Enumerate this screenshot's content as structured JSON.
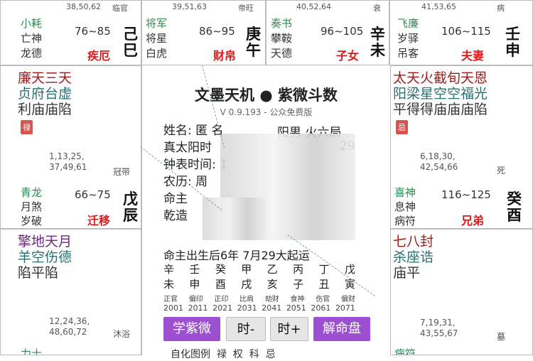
{
  "top_row": [
    {
      "header_nums": "38,50,62",
      "header_stage": "临官",
      "star1": "小耗",
      "star2": "亡神",
      "star3": "龙德",
      "range": "76~85",
      "palace": "疾厄",
      "gz1": "己",
      "gz2": "巳"
    },
    {
      "header_nums": "39,51,63",
      "header_stage": "帝旺",
      "star1": "将军",
      "star2": "将星",
      "star3": "白虎",
      "range": "86~95",
      "palace": "财帛",
      "gz1": "庚",
      "gz2": "午"
    },
    {
      "header_nums": "40,52,64",
      "header_stage": "衰",
      "star1": "奏书",
      "star2": "攀鞍",
      "star3": "天德",
      "range": "96~105",
      "palace": "子女",
      "gz1": "辛",
      "gz2": "未"
    },
    {
      "header_nums": "41,53,65",
      "header_stage": "病",
      "star1": "飞廉",
      "star2": "岁驿",
      "star3": "吊客",
      "range": "106~115",
      "palace": "夫妻",
      "gz1": "壬",
      "gz2": "申"
    }
  ],
  "left_chen": {
    "main_stars": "廉天三天",
    "main_stars2": "贞府台虚",
    "bright": "利庙庙陷",
    "badge": "禄",
    "nums1": "1,13,25,",
    "nums2": "37,49,61",
    "stage": "冠带",
    "star1": "青龙",
    "star2": "月煞",
    "star3": "岁破",
    "range": "66~75",
    "palace": "迁移",
    "gz1": "戊",
    "gz2": "辰"
  },
  "left_mao": {
    "main_stars": "擎地天月",
    "main_stars2": "羊空伤德",
    "bright": "陷平陷",
    "nums1": "12,24,36,",
    "nums2": "48,60,72",
    "stage": "沐浴",
    "bottom": "力士"
  },
  "right_you": {
    "main_stars": "太天火截旬天恩",
    "main_stars2": "阳梁星空空福光",
    "bright": "平得得庙庙庙陷",
    "badge": "忌",
    "nums1": "6,18,30,",
    "nums2": "42,54,66",
    "stage": "死",
    "star1": "喜神",
    "star2": "息神",
    "star3": "病符",
    "range": "116~125",
    "palace": "兄弟",
    "gz1": "癸",
    "gz2": "酉"
  },
  "right_xu": {
    "main_stars": "七八封",
    "main_stars2": "杀座诰",
    "bright": "庙平",
    "nums1": "7,19,31,",
    "nums2": "43,55,67",
    "stage": "墓",
    "bottom": "病符"
  },
  "center": {
    "title": "文墨天机 ● 紫微斗数",
    "version": "V 0.9.193 - 公众免费版",
    "name_label": "姓名: 匿 名",
    "gender": "阳男 火六局",
    "solar_label": "真太阳时",
    "solar_tail": "29",
    "clock_label": "钟表时间: 1",
    "lunar_label": "农历: 周",
    "master_label": "命主",
    "body_label": "乾造",
    "after_birth": "命主出生后6年 7月29大起运",
    "pillars_top": [
      "辛",
      "壬",
      "癸",
      "甲",
      "乙",
      "丙",
      "丁",
      "戊"
    ],
    "pillars_bot": [
      "未",
      "申",
      "酉",
      "戌",
      "亥",
      "子",
      "丑",
      "寅"
    ],
    "ten_gods": [
      "正官",
      "偏印",
      "正印",
      "比肩",
      "劫财",
      "食神",
      "伤官",
      "偏财"
    ],
    "years": [
      "2001",
      "2011",
      "2021",
      "2031",
      "2041",
      "2051",
      "2061",
      "2071"
    ],
    "bottom_row": "自化图例  禄  权  科  忌"
  },
  "buttons": {
    "ziwei": "学紫微",
    "prev": "时-",
    "next": "时+",
    "interpret": "解命盘"
  }
}
